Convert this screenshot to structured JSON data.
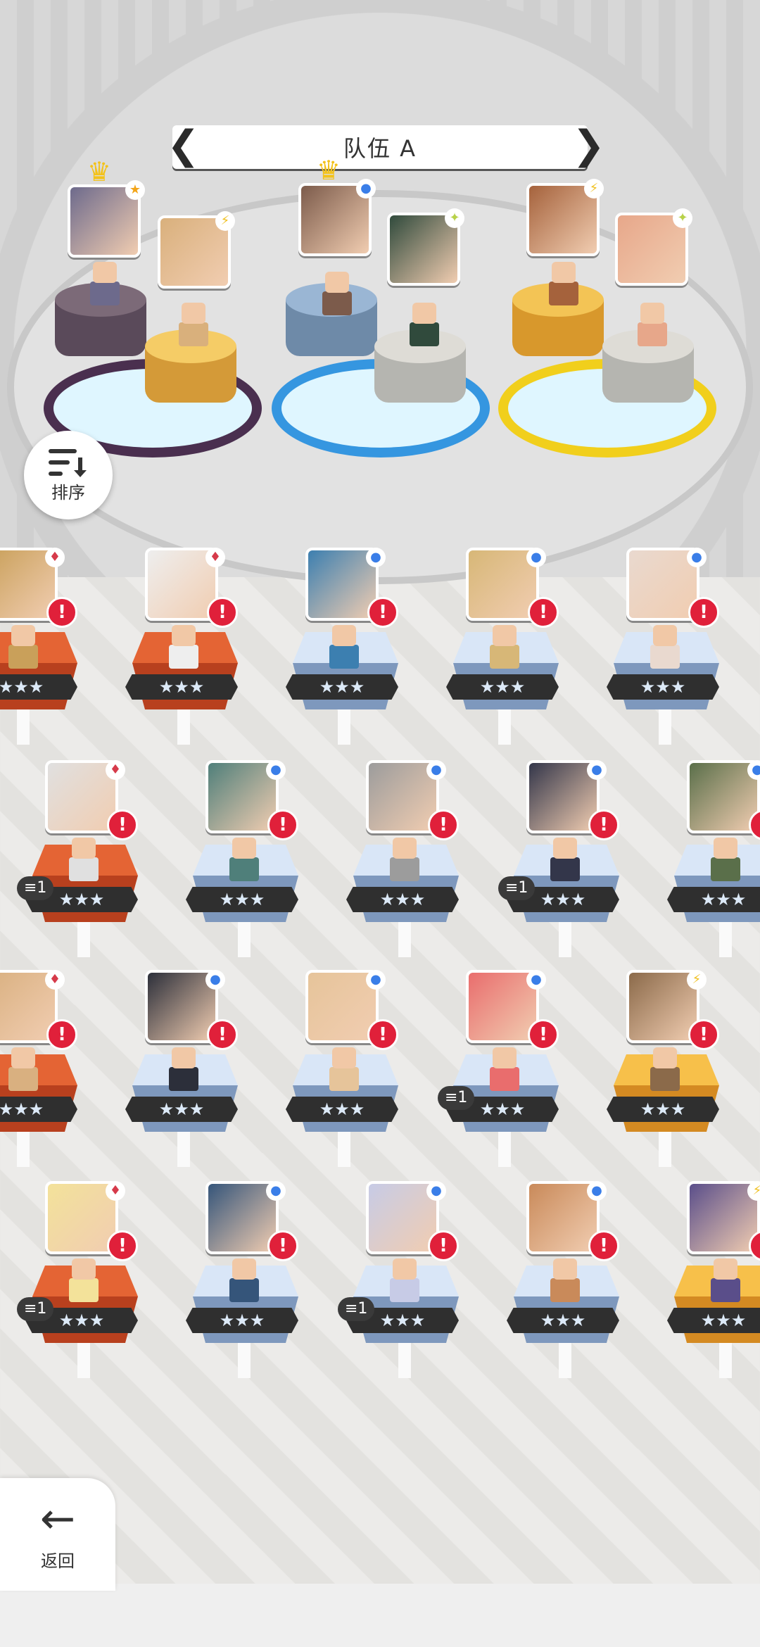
{
  "team": {
    "title": "队伍 A",
    "prev_arrow": "❮",
    "next_arrow": "❯"
  },
  "sort_button": {
    "label": "排序",
    "icon": "sort-icon"
  },
  "back_button": {
    "label": "返回",
    "icon": "back-arrow-icon"
  },
  "crown_icon": "♛",
  "formation": [
    {
      "position": "left-back",
      "badge_icon": "star-icon",
      "badge_color": "#f3a51a",
      "crowned": true,
      "face_color": "#6d6a8c",
      "plate_color": "#5a4a5a",
      "plate_top": "#7c6a78",
      "ring_color": "#4a2f4f"
    },
    {
      "position": "left-front",
      "badge_icon": "bolt-icon",
      "badge_color": "#f0c020",
      "crowned": false,
      "face_color": "#d9b07c",
      "plate_color": "#d49a38",
      "plate_top": "#f5cc66"
    },
    {
      "position": "mid-back",
      "badge_icon": "circle-icon",
      "badge_color": "#3a7ee8",
      "crowned": true,
      "face_color": "#7c5b4b",
      "plate_color": "#6e8aa8",
      "plate_top": "#9ab6d4",
      "ring_color": "#3596e0"
    },
    {
      "position": "mid-front",
      "badge_icon": "sparkle-icon",
      "badge_color": "#b8d24a",
      "crowned": false,
      "face_color": "#304a3c",
      "plate_color": "#b5b5b0",
      "plate_top": "#dedcd6"
    },
    {
      "position": "right-back",
      "badge_icon": "bolt-icon",
      "badge_color": "#f0c020",
      "crowned": false,
      "face_color": "#a5623c",
      "plate_color": "#d8982c",
      "plate_top": "#f3c455",
      "ring_color": "#f1cf1c"
    },
    {
      "position": "right-front",
      "badge_icon": "sparkle-icon",
      "badge_color": "#b8d24a",
      "crowned": false,
      "face_color": "#e7a78a",
      "plate_color": "#b5b5b0",
      "plate_top": "#dedcd6"
    }
  ],
  "roster": {
    "stars_text": "★★★",
    "alert_text": "!",
    "rows": [
      [
        {
          "element": "red",
          "badge_icon": "diamond-icon",
          "face_color": "#c9a05a",
          "level": ""
        },
        {
          "element": "red",
          "badge_icon": "diamond-icon",
          "face_color": "#eeeeee",
          "level": ""
        },
        {
          "element": "blue",
          "badge_icon": "circle-icon",
          "face_color": "#3c7fb0",
          "level": ""
        },
        {
          "element": "blue",
          "badge_icon": "circle-icon",
          "face_color": "#d7b777",
          "level": ""
        },
        {
          "element": "blue",
          "badge_icon": "circle-icon",
          "face_color": "#e9d9cf",
          "level": ""
        },
        {
          "element": "blue",
          "badge_icon": "circle-icon",
          "face_color": "#c9b5a0",
          "level": ""
        }
      ],
      [
        {
          "element": "red",
          "badge_icon": "diamond-icon",
          "face_color": "#e0e0e0",
          "level": "1"
        },
        {
          "element": "blue",
          "badge_icon": "circle-icon",
          "face_color": "#4f7f7a",
          "level": ""
        },
        {
          "element": "blue",
          "badge_icon": "circle-icon",
          "face_color": "#9c9c9c",
          "level": ""
        },
        {
          "element": "blue",
          "badge_icon": "circle-icon",
          "face_color": "#33364a",
          "level": "1"
        },
        {
          "element": "blue",
          "badge_icon": "circle-icon",
          "face_color": "#5a6f4a",
          "level": ""
        }
      ],
      [
        {
          "element": "red",
          "badge_icon": "diamond-icon",
          "face_color": "#d9b080",
          "level": ""
        },
        {
          "element": "blue",
          "badge_icon": "circle-icon",
          "face_color": "#2c2f3a",
          "level": ""
        },
        {
          "element": "blue",
          "badge_icon": "circle-icon",
          "face_color": "#e6c49a",
          "level": ""
        },
        {
          "element": "blue",
          "badge_icon": "circle-icon",
          "face_color": "#e96d6d",
          "level": "1"
        },
        {
          "element": "gold",
          "badge_icon": "bolt-icon",
          "face_color": "#8b6a4a",
          "level": ""
        },
        {
          "element": "gold",
          "badge_icon": "bolt-icon",
          "face_color": "#c9a05a",
          "level": ""
        }
      ],
      [
        {
          "element": "red",
          "badge_icon": "diamond-icon",
          "face_color": "#f3e29a",
          "level": "1"
        },
        {
          "element": "blue",
          "badge_icon": "circle-icon",
          "face_color": "#35557a",
          "level": ""
        },
        {
          "element": "blue",
          "badge_icon": "circle-icon",
          "face_color": "#c7cbe6",
          "level": "1"
        },
        {
          "element": "blue",
          "badge_icon": "circle-icon",
          "face_color": "#c98a5a",
          "level": ""
        },
        {
          "element": "gold",
          "badge_icon": "bolt-icon",
          "face_color": "#5a4e8a",
          "level": ""
        }
      ]
    ]
  },
  "colors": {
    "red_badge": "#d63a4a",
    "blue_badge": "#3a7ee8",
    "gold_badge": "#f0c020",
    "alert": "#e0203a"
  }
}
